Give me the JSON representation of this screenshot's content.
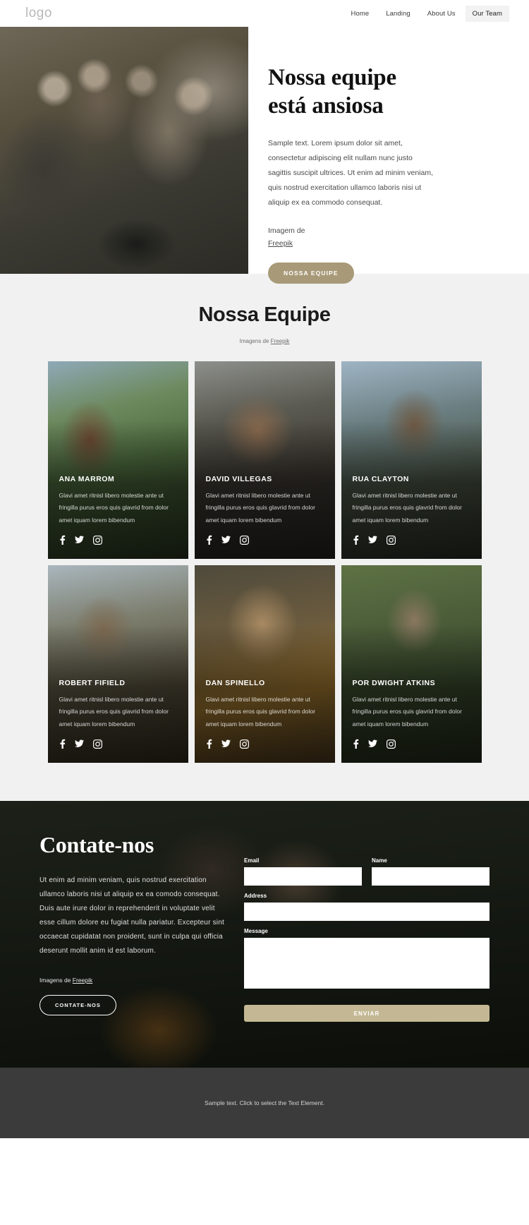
{
  "header": {
    "logo": "logo",
    "nav": [
      {
        "label": "Home",
        "active": false
      },
      {
        "label": "Landing",
        "active": false
      },
      {
        "label": "About Us",
        "active": false
      },
      {
        "label": "Our Team",
        "active": true
      }
    ]
  },
  "hero": {
    "title_line1": "Nossa equipe",
    "title_line2": "está ansiosa",
    "body": "Sample text. Lorem ipsum dolor sit amet, consectetur adipiscing elit nullam nunc justo sagittis suscipit ultrices. Ut enim ad minim veniam, quis nostrud exercitation ullamco laboris nisi ut aliquip ex ea commodo consequat.",
    "credit_label": "Imagem de",
    "credit_link": "Freepik",
    "cta": "NOSSA EQUIPE"
  },
  "team": {
    "title": "Nossa Equipe",
    "subtitle_prefix": "Imagens de ",
    "subtitle_link": "Freepik",
    "members": [
      {
        "name": "ANA MARROM",
        "desc": "Glavi amet ritnisl libero molestie ante ut fringilla purus eros quis glavrid from dolor amet iquam lorem bibendum"
      },
      {
        "name": "DAVID VILLEGAS",
        "desc": "Glavi amet ritnisl libero molestie ante ut fringilla purus eros quis glavrid from dolor amet iquam lorem bibendum"
      },
      {
        "name": "RUA CLAYTON",
        "desc": "Glavi amet ritnisl libero molestie ante ut fringilla purus eros quis glavrid from dolor amet iquam lorem bibendum"
      },
      {
        "name": "ROBERT FIFIELD",
        "desc": "Glavi amet ritnisl libero molestie ante ut fringilla purus eros quis glavrid from dolor amet iquam lorem bibendum"
      },
      {
        "name": "DAN SPINELLO",
        "desc": "Glavi amet ritnisl libero molestie ante ut fringilla purus eros quis glavrid from dolor amet iquam lorem bibendum"
      },
      {
        "name": "POR DWIGHT ATKINS",
        "desc": "Glavi amet ritnisl libero molestie ante ut fringilla purus eros quis glavrid from dolor amet iquam lorem bibendum"
      }
    ],
    "social_icons": [
      "facebook-icon",
      "twitter-icon",
      "instagram-icon"
    ]
  },
  "contact": {
    "title": "Contate-nos",
    "body": "Ut enim ad minim veniam, quis nostrud exercitation ullamco laboris nisi ut aliquip ex ea comodo consequat. Duis aute irure dolor in reprehenderit in voluptate velit esse cillum dolore eu fugiat nulla pariatur. Excepteur sint occaecat cupidatat non proident, sunt in culpa qui officia deserunt mollit anim id est laborum.",
    "credit_prefix": "Imagens de ",
    "credit_link": "Freepik",
    "cta": "CONTATE-NOS",
    "form": {
      "email_label": "Email",
      "email_value": "",
      "email_placeholder": "",
      "name_label": "Name",
      "name_value": "",
      "name_placeholder": "",
      "address_label": "Address",
      "address_value": "",
      "address_placeholder": "",
      "message_label": "Message",
      "message_value": "",
      "message_placeholder": "",
      "submit": "ENVIAR"
    }
  },
  "footer": {
    "text": "Sample text. Click to select the Text Element."
  },
  "colors": {
    "accent": "#a89a78",
    "send_button": "#c4b894",
    "team_bg": "#f1f1f1",
    "footer_bg": "#3b3b3b"
  }
}
